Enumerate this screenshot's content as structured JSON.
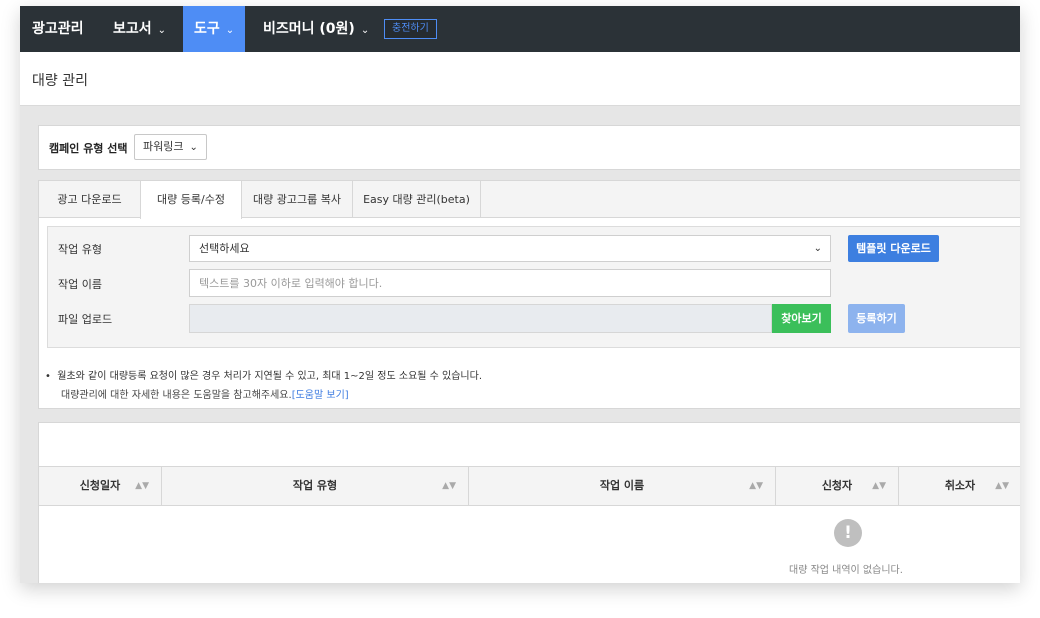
{
  "nav": {
    "brand": "광고관리",
    "report": "보고서",
    "tools": "도구",
    "bizmoney": "비즈머니 (0원)",
    "charge": "충전하기"
  },
  "page": {
    "title": "대량 관리"
  },
  "campaign": {
    "label": "캠페인 유형 선택",
    "selected": "파워링크"
  },
  "tabs": [
    "광고 다운로드",
    "대량 등록/수정",
    "대량 광고그룹 복사",
    "Easy 대량 관리(beta)"
  ],
  "form": {
    "work_type_label": "작업 유형",
    "work_type_value": "선택하세요",
    "template_button": "템플릿 다운로드",
    "work_name_label": "작업 이름",
    "work_name_placeholder": "텍스트를 30자 이하로 입력해야 합니다.",
    "file_upload_label": "파일 업로드",
    "browse_button": "찾아보기",
    "register_button": "등록하기"
  },
  "notice": {
    "line1": "월초와 같이 대량등록 요청이 많은 경우 처리가 지연될 수 있고, 최대 1~2일 정도 소요될 수 있습니다.",
    "line2": "대량관리에 대한 자세한 내용은 도움말을 참고해주세요.",
    "help_link": "[도움말 보기]"
  },
  "table": {
    "columns": [
      "신청일자",
      "작업 유형",
      "작업 이름",
      "신청자",
      "취소자"
    ],
    "empty_message": "대량 작업 내역이 없습니다."
  },
  "colors": {
    "nav_bg": "#2b3237",
    "accent_blue": "#4e8df5",
    "green": "#3bbf5a"
  }
}
